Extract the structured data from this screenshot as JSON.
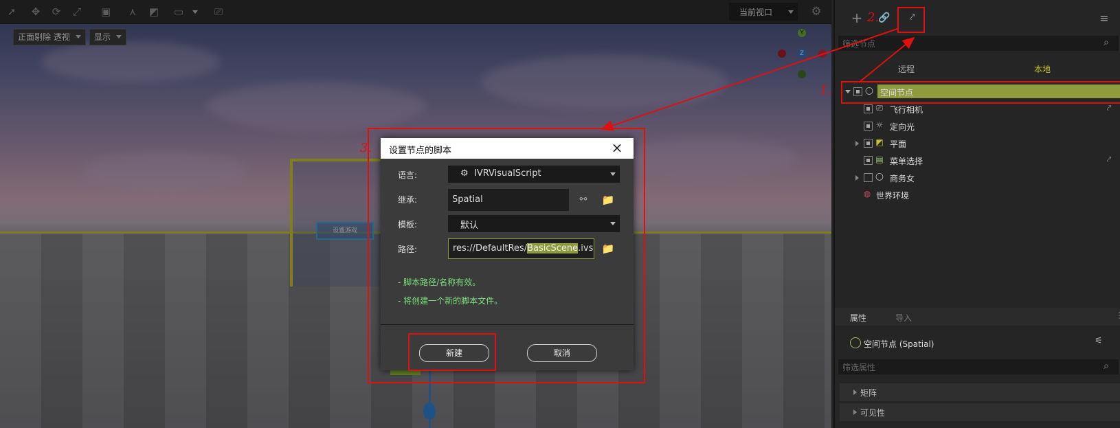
{
  "viewport": {
    "view_select": "当前视口",
    "chip_cull": "正面剔除 透视",
    "chip_display": "显示",
    "gizmo_y": "Y",
    "gizmo_z": "Z",
    "panel_button": "设置游戏"
  },
  "dialog": {
    "title": "设置节点的脚本",
    "language_label": "语言:",
    "language_value": "IVRVisualScript",
    "inherit_label": "继承:",
    "inherit_value": "Spatial",
    "template_label": "模板:",
    "template_value": "默认",
    "path_label": "路径:",
    "path_prefix": "res://DefaultRes/",
    "path_selected": "BasicScene",
    "path_suffix": ".ivs",
    "hint1": "- 脚本路径/名称有效。",
    "hint2": "- 将创建一个新的脚本文件。",
    "create_button": "新建",
    "cancel_button": "取消"
  },
  "scene_panel": {
    "filter_placeholder": "筛选节点",
    "tab_remote": "远程",
    "tab_local": "本地",
    "nodes": [
      {
        "label": "空间节点"
      },
      {
        "label": "飞行相机"
      },
      {
        "label": "定向光"
      },
      {
        "label": "平面"
      },
      {
        "label": "菜单选择"
      },
      {
        "label": "商务女"
      },
      {
        "label": "世界环境"
      }
    ]
  },
  "inspector": {
    "tab_properties": "属性",
    "tab_import": "导入",
    "node_title": "空间节点 (Spatial)",
    "filter_placeholder": "筛选属性",
    "sections": [
      "矩阵",
      "可见性"
    ]
  },
  "annotations": {
    "a1": "1.",
    "a2": "2.",
    "a3": "3."
  },
  "colors": {
    "highlight": "#8f9a3c",
    "annotation": "#e01010",
    "hint": "#7fe07f"
  }
}
